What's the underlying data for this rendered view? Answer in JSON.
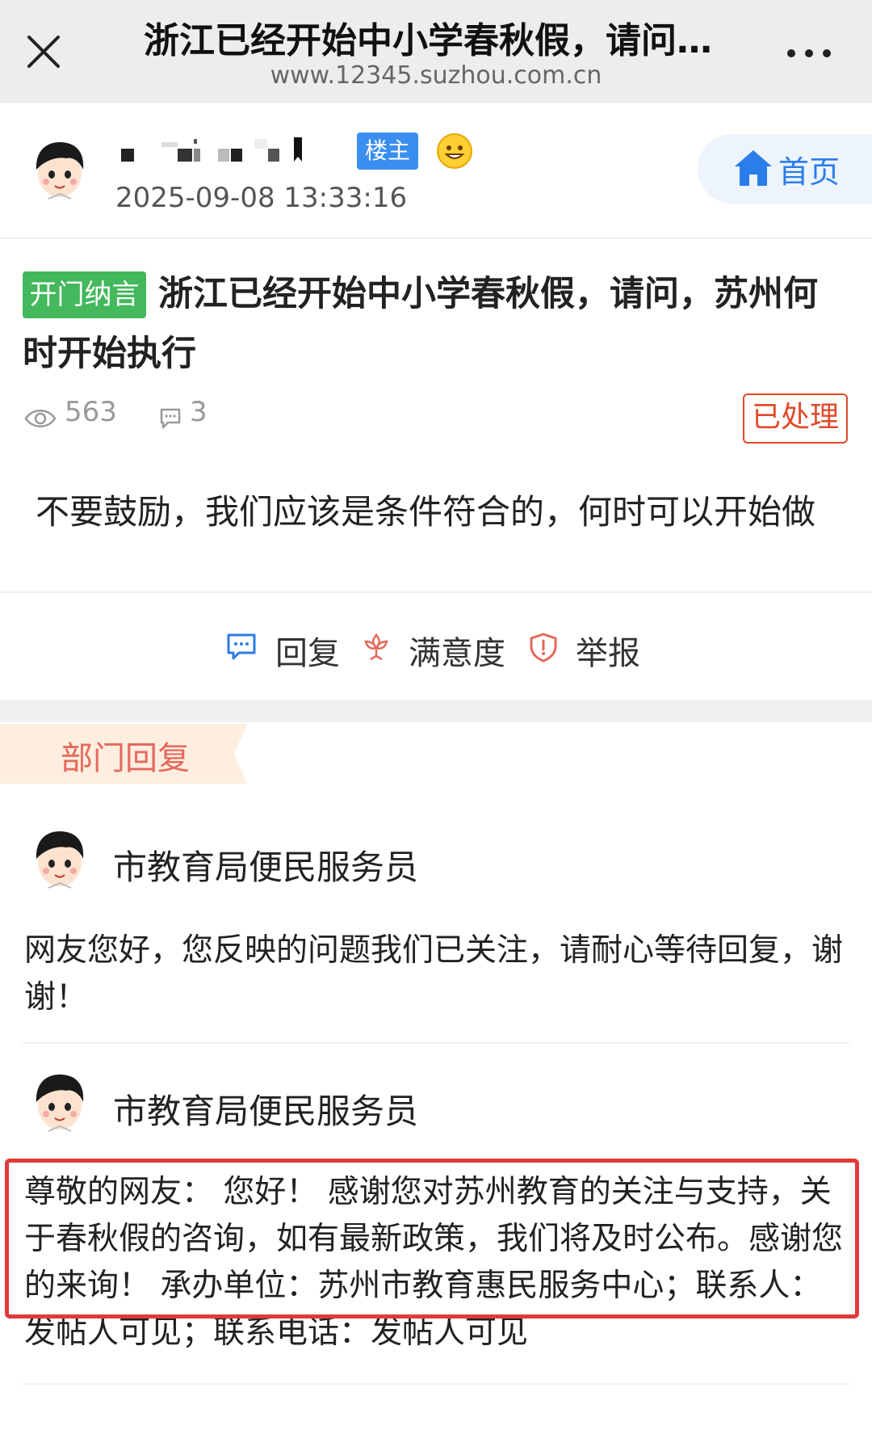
{
  "window": {
    "title": "浙江已经开始中小学春秋假，请问…",
    "url": "www.12345.suzhou.com.cn",
    "close_icon": "close-icon",
    "more_icon": "more-icon"
  },
  "post": {
    "author_badge": "楼主",
    "time": "2025-09-08 13:33:16",
    "home_label": "首页",
    "category_tag": "开门纳言",
    "title": "浙江已经开始中小学春秋假，请问，苏州何时开始执行",
    "views": "563",
    "comments": "3",
    "status": "已处理",
    "content": "不要鼓励，我们应该是条件符合的，何时可以开始做"
  },
  "actions": {
    "reply_label": "回复",
    "satisfaction_label": "满意度",
    "report_label": "举报"
  },
  "department": {
    "section_label": "部门回复",
    "replies": [
      {
        "name": "市教育局便民服务员",
        "text": "网友您好，您反映的问题我们已关注，请耐心等待回复，谢谢！"
      },
      {
        "name": "市教育局便民服务员",
        "text": "尊敬的网友： 您好！ 感谢您对苏州教育的关注与支持，关于春秋假的咨询，如有最新政策，我们将及时公布。感谢您的来询！ 承办单位：苏州市教育惠民服务中心；联系人：发帖人可见；联系电话：发帖人可见"
      }
    ]
  },
  "colors": {
    "topbar_bg": "#ededed",
    "owner_badge": "#3a8ef0",
    "tag_green": "#43b85c",
    "status_red": "#e04a2a",
    "link_blue": "#2b7de9",
    "dept_label": "#e5685a",
    "highlight_border": "#e03a3a"
  }
}
